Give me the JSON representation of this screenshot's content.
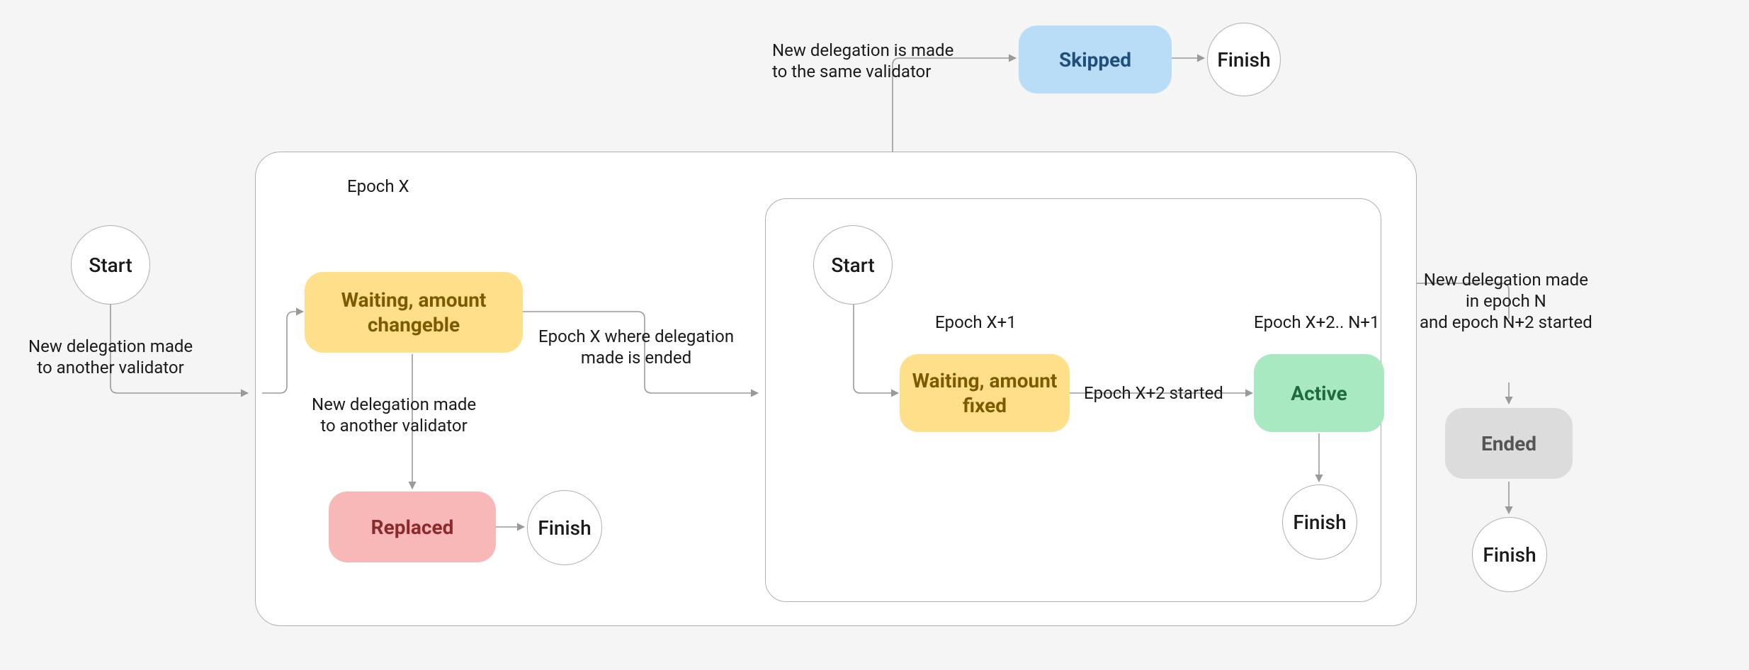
{
  "diagram": {
    "nodes": {
      "start_outer": "Start",
      "start_inner": "Start",
      "waiting_changeable": "Waiting,\namount changeble",
      "waiting_fixed": "Waiting,\namount fixed",
      "replaced": "Replaced",
      "skipped": "Skipped",
      "active": "Active",
      "ended": "Ended",
      "finish_replaced": "Finish",
      "finish_skipped": "Finish",
      "finish_active": "Finish",
      "finish_ended": "Finish"
    },
    "labels": {
      "epoch_x": "Epoch X",
      "epoch_x1": "Epoch X+1",
      "epoch_x2_n1": "Epoch X+2.. N+1",
      "start_to_epoch": "New delegation made\nto another validator",
      "waiting_to_replaced": "New delegation made\nto another validator",
      "epoch_x_ended": "Epoch X where delegation\nmade is ended",
      "epoch_x2_started": "Epoch X+2 started",
      "same_validator": "New delegation is made\nto the same validator",
      "ended_condition": "New delegation made\nin epoch N\nand epoch N+2 started"
    },
    "colors": {
      "yellow": "#ffe08a",
      "red": "#f8b8b8",
      "blue": "#b9dcf7",
      "green": "#a9e9c2",
      "gray": "#dcdcdc",
      "border": "#b0b0b0",
      "bg": "#f5f5f5"
    }
  }
}
